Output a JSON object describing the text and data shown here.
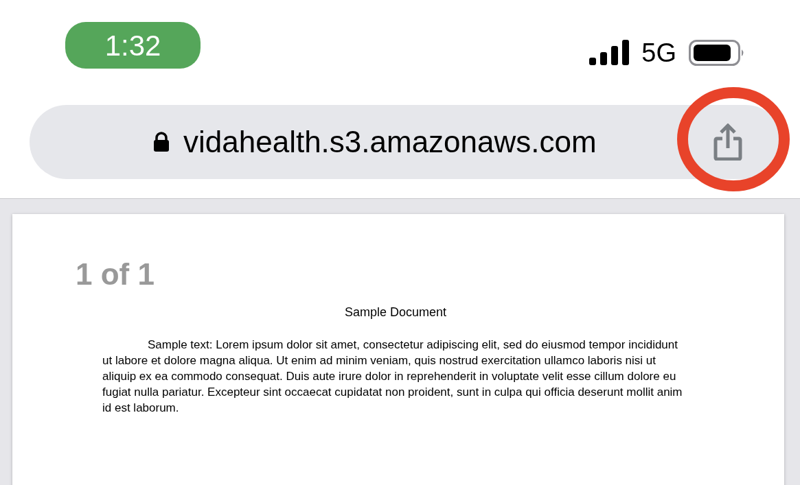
{
  "status_bar": {
    "time": "1:32",
    "network": "5G"
  },
  "address_bar": {
    "url": "vidahealth.s3.amazonaws.com"
  },
  "document": {
    "page_indicator": "1 of 1",
    "title": "Sample Document",
    "body": "Sample text: Lorem ipsum dolor sit amet, consectetur adipiscing elit, sed do eiusmod tempor incididunt ut labore et dolore magna aliqua. Ut enim ad minim veniam, quis nostrud exercitation ullamco laboris nisi ut aliquip ex ea commodo consequat. Duis aute irure dolor in reprehenderit in voluptate velit esse cillum dolore eu fugiat nulla pariatur. Excepteur sint occaecat cupidatat non proident, sunt in culpa qui officia deserunt mollit anim id est laborum."
  }
}
